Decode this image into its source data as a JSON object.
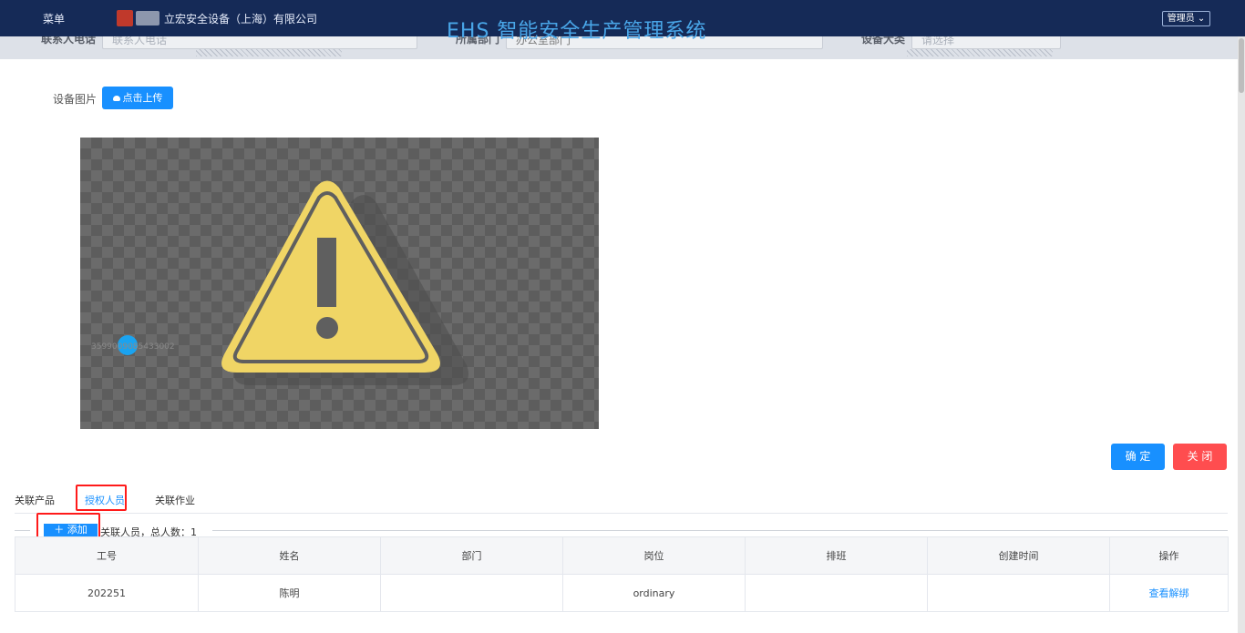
{
  "header": {
    "menu_label": "菜单",
    "company": "立宏安全设备（上海）有限公司",
    "system_title": "EHS 智能安全生产管理系统",
    "user_menu": "管理员"
  },
  "filters": {
    "contact_label": "联系人电话",
    "contact_placeholder": "联系人电话",
    "dept_label": "所属部门",
    "dept_value": "办公室部门",
    "type_label": "设备大类",
    "type_placeholder": "请选择"
  },
  "form": {
    "image_label": "设备图片",
    "upload_label": "点击上传",
    "marker_text": "3599009085433002"
  },
  "actions": {
    "confirm": "确 定",
    "close": "关 闭"
  },
  "tabs": [
    {
      "label": "关联产品",
      "active": false
    },
    {
      "label": "授权人员",
      "active": true
    },
    {
      "label": "关联作业",
      "active": false
    }
  ],
  "section": {
    "add_label": "＋ 添加",
    "title": "关联人员，总人数：1"
  },
  "table": {
    "headers": [
      "工号",
      "姓名",
      "部门",
      "岗位",
      "排班",
      "创建时间",
      "操作"
    ],
    "rows": [
      {
        "id": "202251",
        "name": "陈明",
        "dept": "",
        "post": "ordinary",
        "shift": "",
        "created": "",
        "view": "查看",
        "unbind": "解绑"
      }
    ]
  },
  "colors": {
    "header_bg": "#152a57",
    "primary": "#1890ff",
    "danger": "#ff4d4f",
    "highlight": "#ff1a1a",
    "warning_yellow": "#f0d565"
  }
}
